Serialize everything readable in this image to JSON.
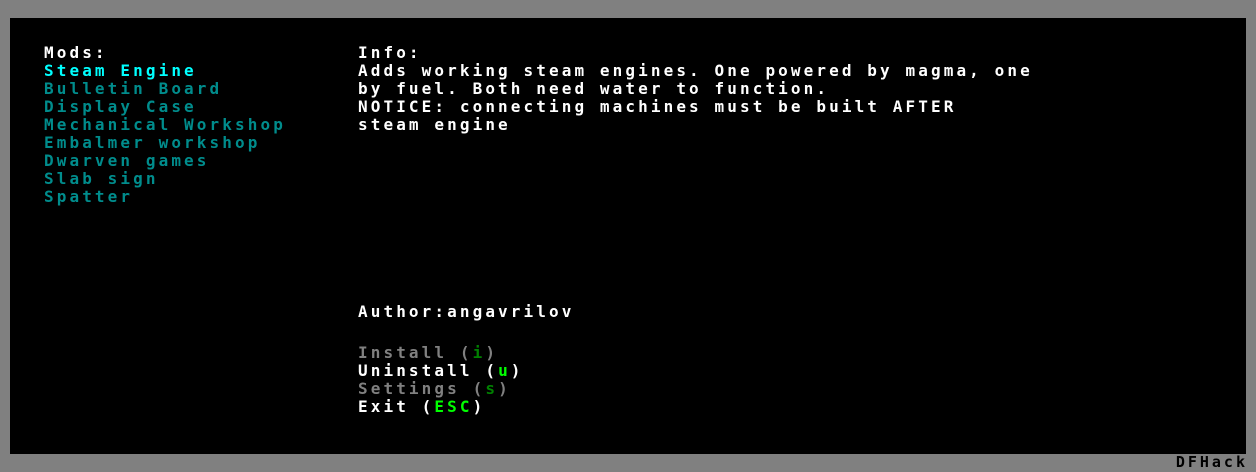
{
  "mods_panel": {
    "header": "Mods:",
    "items": [
      {
        "label": "Steam Engine",
        "selected": true
      },
      {
        "label": "Bulletin Board",
        "selected": false
      },
      {
        "label": "Display Case",
        "selected": false
      },
      {
        "label": "Mechanical Workshop",
        "selected": false
      },
      {
        "label": "Embalmer workshop",
        "selected": false
      },
      {
        "label": "Dwarven games",
        "selected": false
      },
      {
        "label": "Slab sign",
        "selected": false
      },
      {
        "label": "Spatter",
        "selected": false
      }
    ]
  },
  "info_panel": {
    "header": "Info:",
    "lines": [
      "Adds working steam engines. One powered by magma, one",
      "by fuel. Both need water to function.",
      "NOTICE: connecting machines must be built AFTER",
      "steam engine"
    ],
    "author": "Author:angavrilov"
  },
  "actions": {
    "install": {
      "label": "Install (",
      "key": "i",
      "close": ")",
      "enabled": false
    },
    "uninstall": {
      "label": "Uninstall (",
      "key": "u",
      "close": ")",
      "enabled": true
    },
    "settings": {
      "label": "Settings (",
      "key": "s",
      "close": ")",
      "enabled": false
    },
    "exit": {
      "label": "Exit (",
      "key": "ESC",
      "close": ")",
      "enabled": true
    }
  },
  "footer": {
    "tag": "DFHack"
  },
  "colors": {
    "background": "#000000",
    "frame": "#808080",
    "selected_item": "#00ffff",
    "list_item": "#008c8c",
    "text": "#ffffff",
    "disabled_text": "#808080",
    "hotkey": "#00ff00",
    "hotkey_dim": "#008000"
  }
}
